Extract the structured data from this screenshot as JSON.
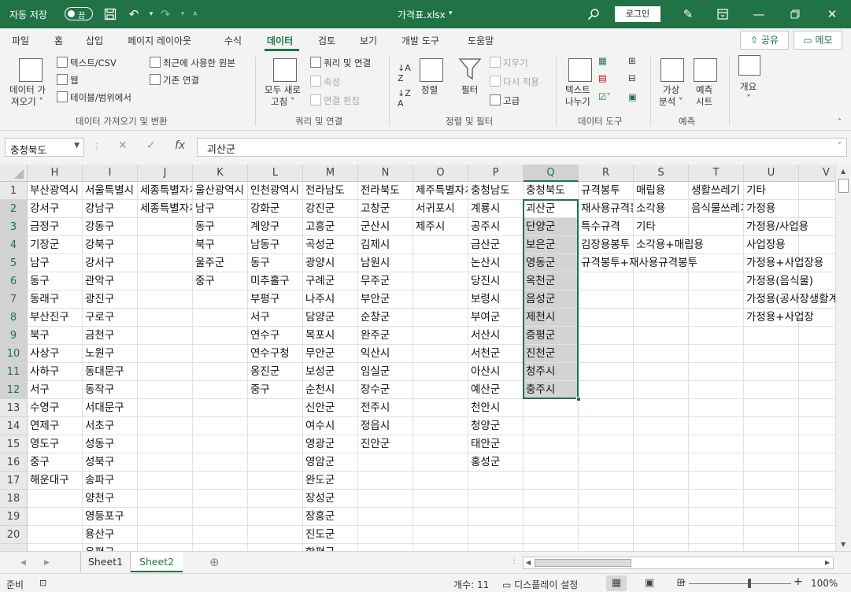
{
  "titlebar": {
    "autosave_label": "자동 저장",
    "autosave_state": "끔",
    "filename": "가격표.xlsx",
    "filename_caret": "▾",
    "login": "로그인"
  },
  "menu": {
    "items": [
      "파일",
      "홈",
      "삽입",
      "페이지 레이아웃",
      "수식",
      "데이터",
      "검토",
      "보기",
      "개발 도구",
      "도움말"
    ],
    "active": "데이터",
    "share": "공유",
    "memo": "메모"
  },
  "ribbon": {
    "get_data": "데이터 가\n져오기 ▾",
    "get_data_l1": "데이터 가",
    "get_data_l2": "져오기 ˅",
    "text_csv": "텍스트/CSV",
    "web": "웹",
    "table_range": "테이블/범위에서",
    "recent_sources": "최근에 사용한 원본",
    "existing_conn": "기존 연결",
    "group_get": "데이터 가져오기 및 변환",
    "refresh_l1": "모두 새로",
    "refresh_l2": "고침 ˅",
    "queries_conn": "쿼리 및 연결",
    "properties": "속성",
    "edit_links": "연결 편집",
    "group_queries": "쿼리 및 연결",
    "sort": "정렬",
    "filter": "필터",
    "clear": "지우기",
    "reapply": "다시 적용",
    "advanced": "고급",
    "group_sort": "정렬 및 필터",
    "text_to_col_l1": "텍스트",
    "text_to_col_l2": "나누기",
    "group_tools": "데이터 도구",
    "whatif_l1": "가상",
    "whatif_l2": "분석 ˅",
    "forecast_l1": "예측",
    "forecast_l2": "시트",
    "group_forecast": "예측",
    "outline": "개요",
    "outline_caret": "˅"
  },
  "formula_bar": {
    "name_box": "충청북도",
    "content": "괴산군"
  },
  "grid": {
    "columns": [
      "H",
      "I",
      "J",
      "K",
      "L",
      "M",
      "N",
      "O",
      "P",
      "Q",
      "R",
      "S",
      "T",
      "U",
      "V"
    ],
    "selected_column": "Q",
    "row_numbers": [
      "1",
      "2",
      "3",
      "4",
      "5",
      "6",
      "7",
      "8",
      "9",
      "10",
      "11",
      "12",
      "13",
      "14",
      "15",
      "16",
      "17",
      "18",
      "19",
      "20",
      ""
    ],
    "rows": [
      [
        "부산광역시",
        "서울특별시",
        "세종특별자치시",
        "울산광역시",
        "인천광역시",
        "전라남도",
        "전라북도",
        "제주특별자치도",
        "충청남도",
        "충청북도",
        "규격봉투",
        "매립용",
        "생활쓰레기",
        "기타",
        ""
      ],
      [
        "강서구",
        "강남구",
        "세종특별자치시",
        "남구",
        "강화군",
        "강진군",
        "고창군",
        "서귀포시",
        "계룡시",
        "괴산군",
        "재사용규격봉투",
        "소각용",
        "음식물쓰레기",
        "가정용",
        ""
      ],
      [
        "금정구",
        "강동구",
        "",
        "동구",
        "계양구",
        "고흥군",
        "군산시",
        "제주시",
        "공주시",
        "단양군",
        "특수규격",
        "기타",
        "",
        "가정용/사업용",
        ""
      ],
      [
        "기장군",
        "강북구",
        "",
        "북구",
        "남동구",
        "곡성군",
        "김제시",
        "",
        "금산군",
        "보은군",
        "김장용봉투",
        "소각용+매립용",
        "",
        "사업장용",
        ""
      ],
      [
        "남구",
        "강서구",
        "",
        "울주군",
        "동구",
        "광양시",
        "남원시",
        "",
        "논산시",
        "영동군",
        "규격봉투+재사용규격봉투",
        "",
        "",
        "가정용+사업장용",
        ""
      ],
      [
        "동구",
        "관악구",
        "",
        "중구",
        "미추홀구",
        "구례군",
        "무주군",
        "",
        "당진시",
        "옥천군",
        "",
        "",
        "",
        "가정용(음식물)",
        ""
      ],
      [
        "동래구",
        "광진구",
        "",
        "",
        "부평구",
        "나주시",
        "부안군",
        "",
        "보령시",
        "음성군",
        "",
        "",
        "",
        "가정용(공사장생활계)",
        ""
      ],
      [
        "부산진구",
        "구로구",
        "",
        "",
        "서구",
        "담양군",
        "순창군",
        "",
        "부여군",
        "제천시",
        "",
        "",
        "",
        "가정용+사업장",
        ""
      ],
      [
        "북구",
        "금천구",
        "",
        "",
        "연수구",
        "목포시",
        "완주군",
        "",
        "서산시",
        "증평군",
        "",
        "",
        "",
        "",
        ""
      ],
      [
        "사상구",
        "노원구",
        "",
        "",
        "연수구청",
        "무안군",
        "익산시",
        "",
        "서천군",
        "진천군",
        "",
        "",
        "",
        "",
        ""
      ],
      [
        "사하구",
        "동대문구",
        "",
        "",
        "옹진군",
        "보성군",
        "임실군",
        "",
        "아산시",
        "청주시",
        "",
        "",
        "",
        "",
        ""
      ],
      [
        "서구",
        "동작구",
        "",
        "",
        "중구",
        "순천시",
        "장수군",
        "",
        "예산군",
        "충주시",
        "",
        "",
        "",
        "",
        ""
      ],
      [
        "수영구",
        "서대문구",
        "",
        "",
        "",
        "신안군",
        "전주시",
        "",
        "천안시",
        "",
        "",
        "",
        "",
        "",
        ""
      ],
      [
        "연제구",
        "서초구",
        "",
        "",
        "",
        "여수시",
        "정읍시",
        "",
        "청양군",
        "",
        "",
        "",
        "",
        "",
        ""
      ],
      [
        "영도구",
        "성동구",
        "",
        "",
        "",
        "영광군",
        "진안군",
        "",
        "태안군",
        "",
        "",
        "",
        "",
        "",
        ""
      ],
      [
        "중구",
        "성북구",
        "",
        "",
        "",
        "영암군",
        "",
        "",
        "홍성군",
        "",
        "",
        "",
        "",
        "",
        ""
      ],
      [
        "해운대구",
        "송파구",
        "",
        "",
        "",
        "완도군",
        "",
        "",
        "",
        "",
        "",
        "",
        "",
        "",
        ""
      ],
      [
        "",
        "양천구",
        "",
        "",
        "",
        "장성군",
        "",
        "",
        "",
        "",
        "",
        "",
        "",
        "",
        ""
      ],
      [
        "",
        "영등포구",
        "",
        "",
        "",
        "장흥군",
        "",
        "",
        "",
        "",
        "",
        "",
        "",
        "",
        ""
      ],
      [
        "",
        "용산구",
        "",
        "",
        "",
        "진도군",
        "",
        "",
        "",
        "",
        "",
        "",
        "",
        "",
        ""
      ],
      [
        "",
        "은평구",
        "",
        "",
        "",
        "함평군",
        "",
        "",
        "",
        "",
        "",
        "",
        "",
        "",
        ""
      ]
    ]
  },
  "sheets": {
    "tabs": [
      "Sheet1",
      "Sheet2"
    ],
    "active": "Sheet2",
    "add_icon": "⊕"
  },
  "status": {
    "ready": "준비",
    "count": "개수: 11",
    "display_settings": "디스플레이 설정",
    "zoom": "100%",
    "zoom_minus": "-",
    "zoom_plus": "+"
  }
}
